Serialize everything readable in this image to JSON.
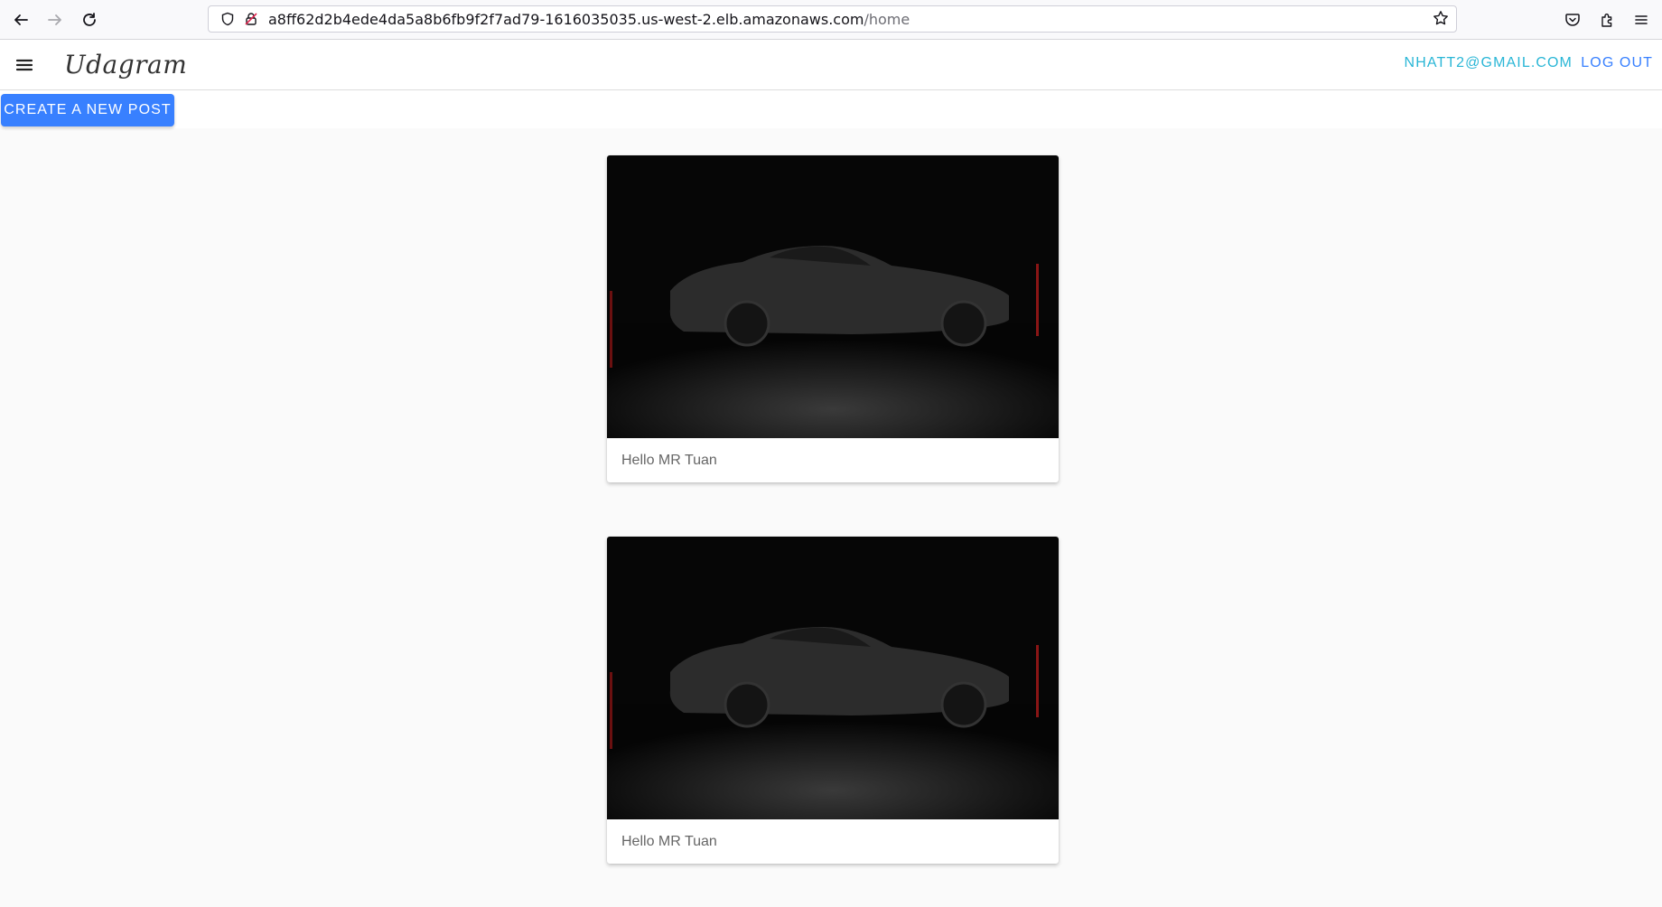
{
  "browser": {
    "url_host": "a8ff62d2b4ede4da5a8b6fb9f2f7ad79-1616035035.us-west-2.elb.amazonaws.com",
    "url_path": "/home"
  },
  "app": {
    "brand": "Udagram",
    "user_email": "NHATT2@GMAIL.COM",
    "logout_label": "LOG OUT",
    "create_post_label": "CREATE A NEW POST"
  },
  "feed": {
    "posts": [
      {
        "caption": "Hello MR Tuan",
        "image": "dark-car-side-view"
      },
      {
        "caption": "Hello MR Tuan",
        "image": "dark-car-side-view"
      }
    ]
  },
  "colors": {
    "primary": "#3880ff",
    "email": "#29b6d6",
    "background": "#fafafa"
  }
}
